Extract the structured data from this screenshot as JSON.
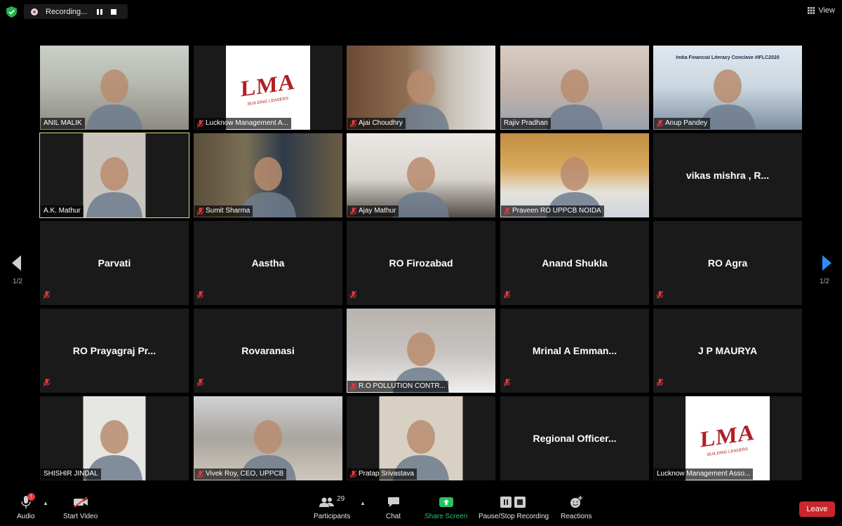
{
  "recording": {
    "label": "Recording..."
  },
  "view": {
    "label": "View"
  },
  "pager": {
    "left": "1/2",
    "right": "1/2"
  },
  "tiles": [
    {
      "name": "ANIL MALIK",
      "video": true,
      "muted": false
    },
    {
      "name": "Lucknow Management A...",
      "video": true,
      "muted": true,
      "logo": "LMA"
    },
    {
      "name": "Ajai Choudhry",
      "video": true,
      "muted": true
    },
    {
      "name": "Rajiv Pradhan",
      "video": true,
      "muted": false
    },
    {
      "name": "Anup Pandey",
      "video": true,
      "muted": true,
      "banner": "India Financial Literacy Conclave #IFLC2020"
    },
    {
      "name": "A.K. Mathur",
      "video": true,
      "muted": false,
      "active": true
    },
    {
      "name": "Sumit Sharma",
      "video": true,
      "muted": true
    },
    {
      "name": "Ajay Mathur",
      "video": true,
      "muted": true
    },
    {
      "name": "Praveen RO UPPCB NOIDA",
      "video": true,
      "muted": true
    },
    {
      "name": "vikas mishra , R...",
      "video": false,
      "muted": false
    },
    {
      "name": "Parvati",
      "video": false,
      "muted": true
    },
    {
      "name": "Aastha",
      "video": false,
      "muted": true
    },
    {
      "name": "RO Firozabad",
      "video": false,
      "muted": true
    },
    {
      "name": "Anand Shukla",
      "video": false,
      "muted": true
    },
    {
      "name": "RO Agra",
      "video": false,
      "muted": true
    },
    {
      "name": "RO Prayagraj Pr...",
      "video": false,
      "muted": true
    },
    {
      "name": "Rovaranasi",
      "video": false,
      "muted": true
    },
    {
      "name": "R.O POLLUTION CONTR...",
      "video": true,
      "muted": true
    },
    {
      "name": "Mrinal  A  Emman...",
      "video": false,
      "muted": true
    },
    {
      "name": "J P MAURYA",
      "video": false,
      "muted": true
    },
    {
      "name": "SHISHIR JINDAL",
      "video": true,
      "muted": false
    },
    {
      "name": "Vivek Roy, CEO, UPPCB",
      "video": true,
      "muted": true
    },
    {
      "name": "Pratap Srivastava",
      "video": true,
      "muted": true
    },
    {
      "name": "Regional  Officer...",
      "video": false,
      "muted": false
    },
    {
      "name": "Lucknow Management Asso...",
      "video": true,
      "muted": false,
      "logo": "LMA"
    }
  ],
  "logo": {
    "main": "LMA",
    "sub": "BUILDING LEADERS"
  },
  "toolbar": {
    "audio": "Audio",
    "audio_badge": "!",
    "start_video": "Start Video",
    "participants": "Participants",
    "participants_count": "29",
    "chat": "Chat",
    "share_screen": "Share Screen",
    "recording": "Pause/Stop Recording",
    "reactions": "Reactions",
    "leave": "Leave"
  },
  "colors": {
    "active_border": "#dddd72",
    "share_green": "#27c263",
    "leave_red": "#c9272d",
    "tile_bg": "#1a1a1a"
  }
}
